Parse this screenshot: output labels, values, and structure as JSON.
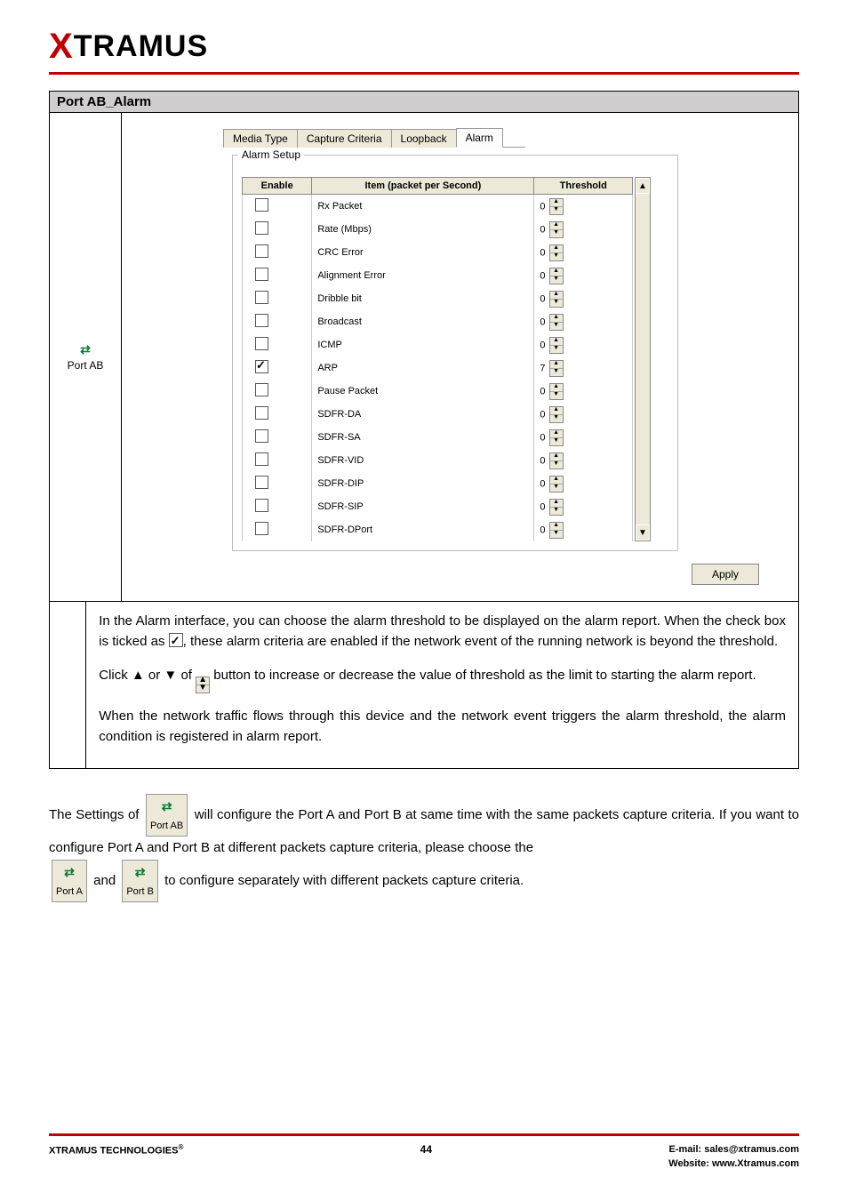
{
  "brand": {
    "x": "X",
    "rest": "TRAMUS"
  },
  "section_title": "Port AB_Alarm",
  "port_ab_label": "Port AB",
  "tabs": {
    "media": "Media Type",
    "capture": "Capture Criteria",
    "loopback": "Loopback",
    "alarm": "Alarm"
  },
  "fieldset_legend": "Alarm Setup",
  "columns": {
    "enable": "Enable",
    "item": "Item (packet per Second)",
    "threshold": "Threshold"
  },
  "rows": [
    {
      "enabled": false,
      "item": "Rx Packet",
      "threshold": "0"
    },
    {
      "enabled": false,
      "item": "Rate (Mbps)",
      "threshold": "0"
    },
    {
      "enabled": false,
      "item": "CRC Error",
      "threshold": "0"
    },
    {
      "enabled": false,
      "item": "Alignment Error",
      "threshold": "0"
    },
    {
      "enabled": false,
      "item": "Dribble bit",
      "threshold": "0"
    },
    {
      "enabled": false,
      "item": "Broadcast",
      "threshold": "0"
    },
    {
      "enabled": false,
      "item": "ICMP",
      "threshold": "0"
    },
    {
      "enabled": true,
      "item": "ARP",
      "threshold": "7"
    },
    {
      "enabled": false,
      "item": "Pause Packet",
      "threshold": "0"
    },
    {
      "enabled": false,
      "item": "SDFR-DA",
      "threshold": "0"
    },
    {
      "enabled": false,
      "item": "SDFR-SA",
      "threshold": "0"
    },
    {
      "enabled": false,
      "item": "SDFR-VID",
      "threshold": "0"
    },
    {
      "enabled": false,
      "item": "SDFR-DIP",
      "threshold": "0"
    },
    {
      "enabled": false,
      "item": "SDFR-SIP",
      "threshold": "0"
    },
    {
      "enabled": false,
      "item": "SDFR-DPort",
      "threshold": "0"
    }
  ],
  "apply_label": "Apply",
  "desc": {
    "p1a": "In the Alarm interface, you can choose the alarm threshold to be displayed on the alarm report. When the check box is ticked as",
    "p1b": ", these alarm criteria are enabled if the network event of the running network is beyond the threshold.",
    "p2a": "Click ▲ or ▼ of ",
    "p2b": " button to increase or decrease the value of threshold as the limit to starting the alarm report.",
    "p3": "When the network traffic flows through this device and the network event triggers the alarm threshold, the alarm condition is registered in alarm report."
  },
  "body": {
    "s1": "The Settings of ",
    "s2": " will configure the Port A and Port B at same time with the same packets capture criteria. If you want to configure Port A and Port B at different packets capture criteria, please choose the ",
    "s3": " and ",
    "s4": "  to configure separately with different packets capture criteria."
  },
  "port_labels": {
    "ab": "Port AB",
    "a": "Port A",
    "b": "Port B"
  },
  "footer": {
    "left": "XTRAMUS TECHNOLOGIES",
    "reg": "®",
    "page": "44",
    "email_label": "E-mail: ",
    "email": "sales@xtramus.com",
    "site_label": "Website:  ",
    "site": "www.Xtramus.com"
  },
  "glyphs": {
    "up": "▲",
    "down": "▼"
  }
}
